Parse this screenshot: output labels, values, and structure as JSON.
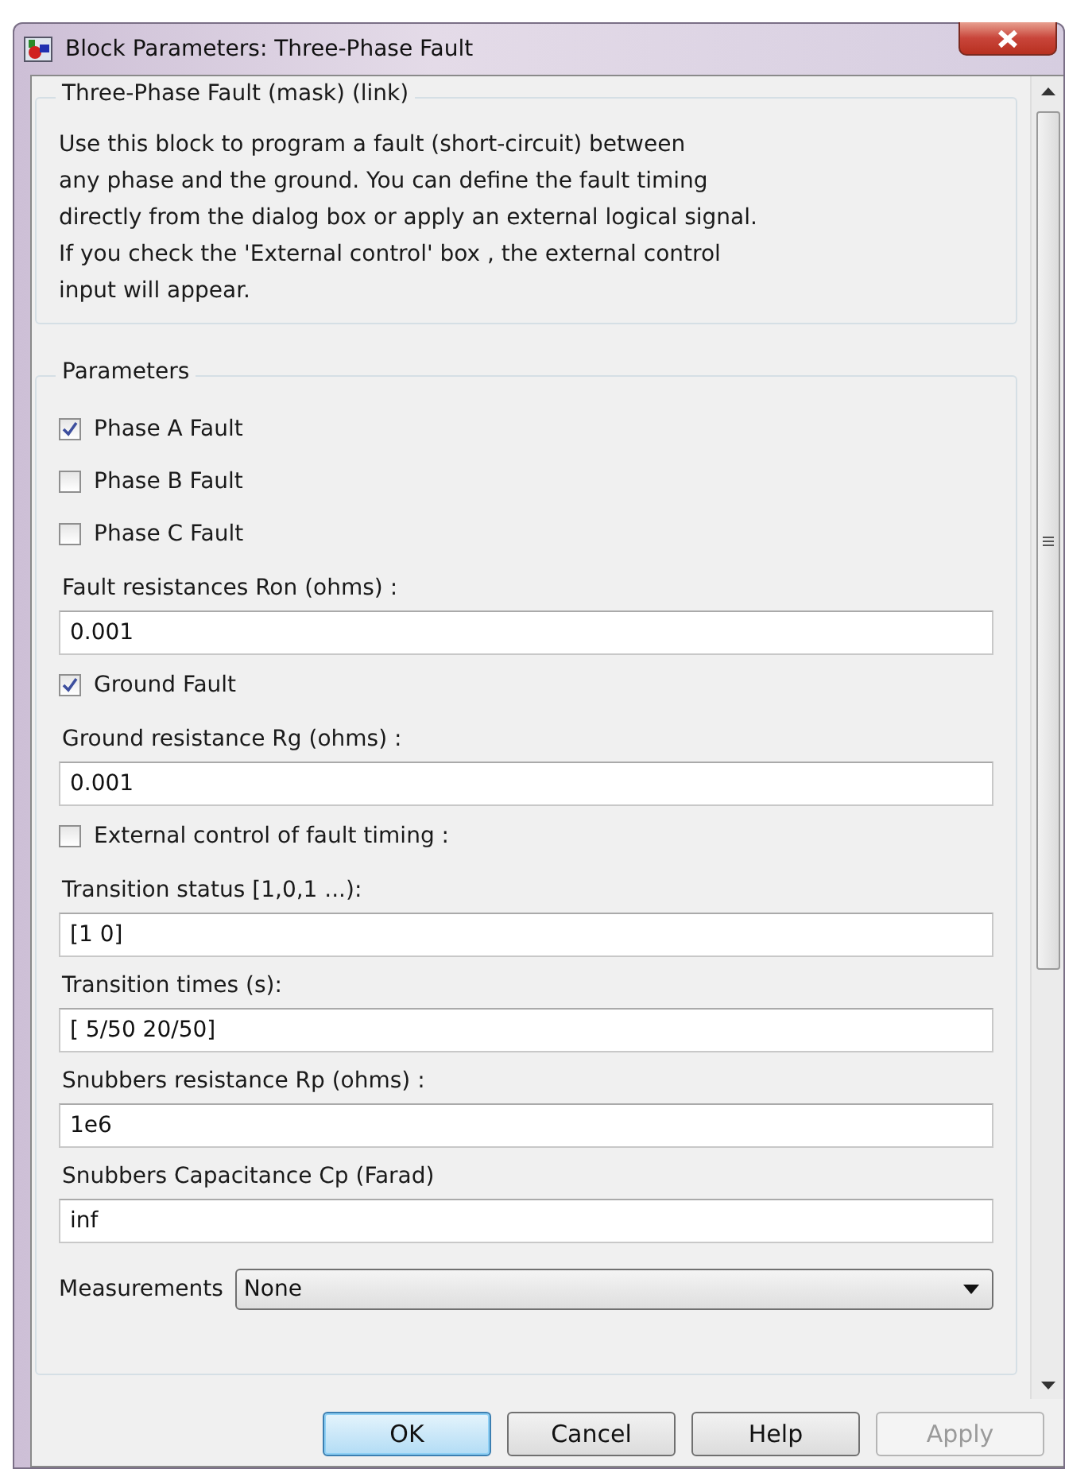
{
  "window": {
    "title": "Block Parameters: Three-Phase Fault"
  },
  "description": {
    "title": "Three-Phase Fault (mask) (link)",
    "text": "Use this block to program a fault (short-circuit) between\nany phase and the ground. You can define the fault timing\ndirectly from the dialog box or apply an external logical signal.\nIf you check the 'External control' box , the external control\ninput will appear."
  },
  "parameters": {
    "title": "Parameters",
    "items": [
      {
        "kind": "checkbox",
        "label": "Phase A Fault",
        "checked": true
      },
      {
        "kind": "checkbox",
        "label": "Phase B Fault",
        "checked": false
      },
      {
        "kind": "checkbox",
        "label": "Phase C Fault",
        "checked": false
      },
      {
        "kind": "field",
        "label": "Fault resistances  Ron (ohms) :",
        "value": "0.001"
      },
      {
        "kind": "checkbox",
        "label": "Ground Fault",
        "checked": true
      },
      {
        "kind": "field",
        "label": "Ground resistance Rg (ohms) :",
        "value": "0.001"
      },
      {
        "kind": "checkbox",
        "label": "External control of fault timing :",
        "checked": false
      },
      {
        "kind": "field",
        "label": "Transition status [1,0,1 ...):",
        "value": "[1 0]"
      },
      {
        "kind": "field",
        "label": "Transition times (s):",
        "value": "[ 5/50 20/50]"
      },
      {
        "kind": "field",
        "label": "Snubbers resistance Rp (ohms) :",
        "value": "1e6"
      },
      {
        "kind": "field",
        "label": "Snubbers Capacitance Cp (Farad)",
        "value": "inf"
      },
      {
        "kind": "select",
        "label": "Measurements",
        "value": "None"
      }
    ]
  },
  "buttons": [
    {
      "label": "OK",
      "default": true,
      "disabled": false
    },
    {
      "label": "Cancel",
      "default": false,
      "disabled": false
    },
    {
      "label": "Help",
      "default": false,
      "disabled": false
    },
    {
      "label": "Apply",
      "default": false,
      "disabled": true
    }
  ]
}
